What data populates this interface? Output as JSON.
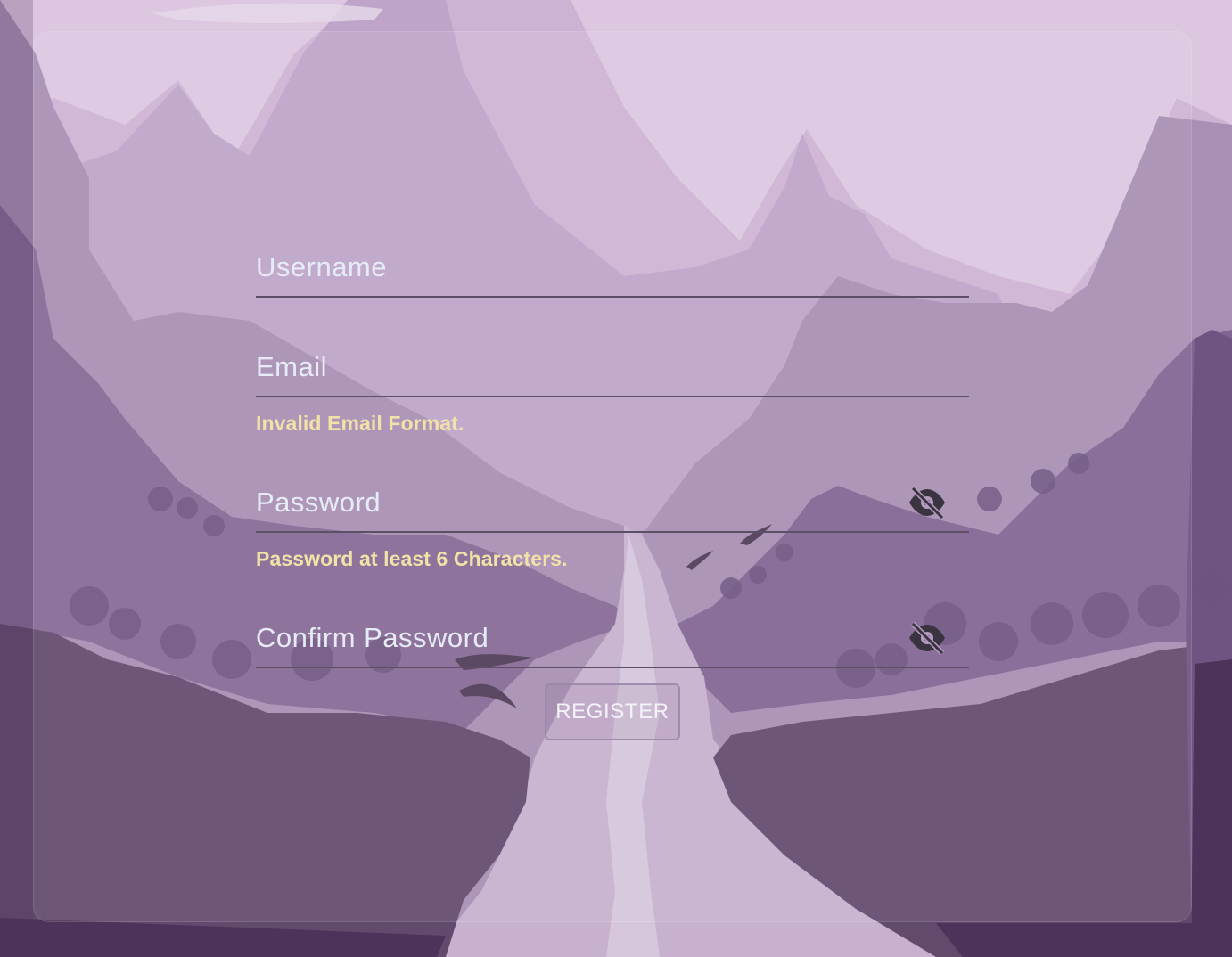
{
  "form": {
    "username": {
      "placeholder": "Username",
      "value": ""
    },
    "email": {
      "placeholder": "Email",
      "value": "",
      "error": "Invalid Email Format."
    },
    "password": {
      "placeholder": "Password",
      "value": "",
      "error": "Password at least 6 Characters.",
      "toggle_icon": "eye-off-icon"
    },
    "confirm_password": {
      "placeholder": "Confirm Password",
      "value": "",
      "toggle_icon": "eye-off-icon"
    },
    "register_label": "REGISTER"
  },
  "colors": {
    "error_text": "#f2e2a8",
    "input_underline": "#5d4f66",
    "placeholder": "#e6ecf6",
    "background_light": "#dcc6e0",
    "background_dark": "#4d3359"
  }
}
